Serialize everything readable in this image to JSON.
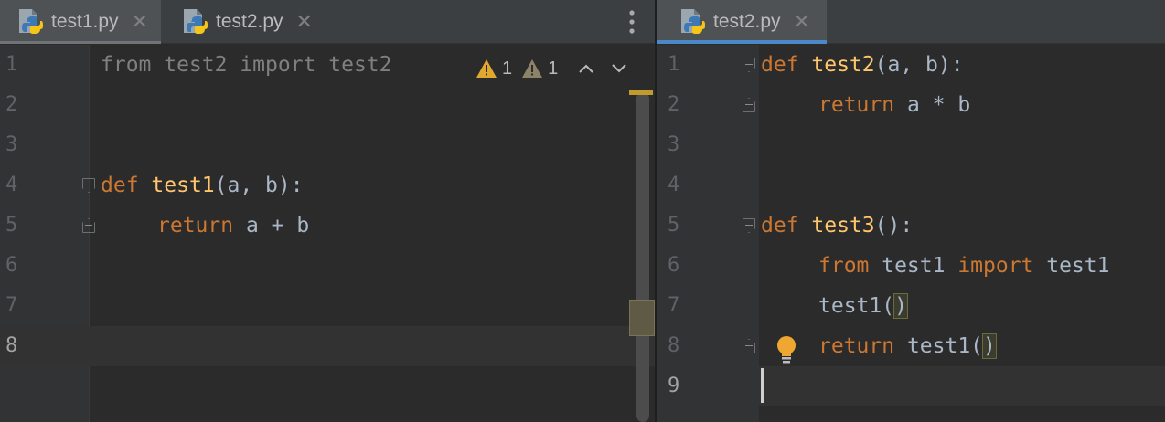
{
  "left": {
    "tabs": [
      {
        "label": "test1.py",
        "close": "✕"
      },
      {
        "label": "test2.py",
        "close": "✕"
      }
    ],
    "inspections": {
      "warnings_a": "1",
      "warnings_b": "1"
    },
    "lines": [
      "1",
      "2",
      "3",
      "4",
      "5",
      "6",
      "7",
      "8"
    ],
    "code": {
      "l1": "from test2 import test2",
      "l4_kw": "def",
      "l4_fn": "test1",
      "l4_rest": "(a, b):",
      "l5_kw": "return",
      "l5_rest": " a + b"
    }
  },
  "right": {
    "tabs": [
      {
        "label": "test2.py",
        "close": "✕"
      }
    ],
    "lines": [
      "1",
      "2",
      "3",
      "4",
      "5",
      "6",
      "7",
      "8",
      "9"
    ],
    "code": {
      "l1_kw": "def",
      "l1_fn": "test2",
      "l1_rest": "(a, b):",
      "l2_kw": "return",
      "l2_rest": " a * b",
      "l5_kw": "def",
      "l5_fn": "test3",
      "l5_rest": "():",
      "l6_kw1": "from",
      "l6_mod": " test1 ",
      "l6_kw2": "import",
      "l6_name": " test1",
      "l7_name": "test1(",
      "l7_paren": ")",
      "l8_kw": "return",
      "l8_name": " test1(",
      "l8_paren": ")"
    }
  },
  "colors": {
    "keyword": "#cc7832",
    "function": "#ffc66d",
    "text": "#a9b7c6",
    "warning": "#e0a82e",
    "active_tab_underline": "#4a88c7"
  }
}
